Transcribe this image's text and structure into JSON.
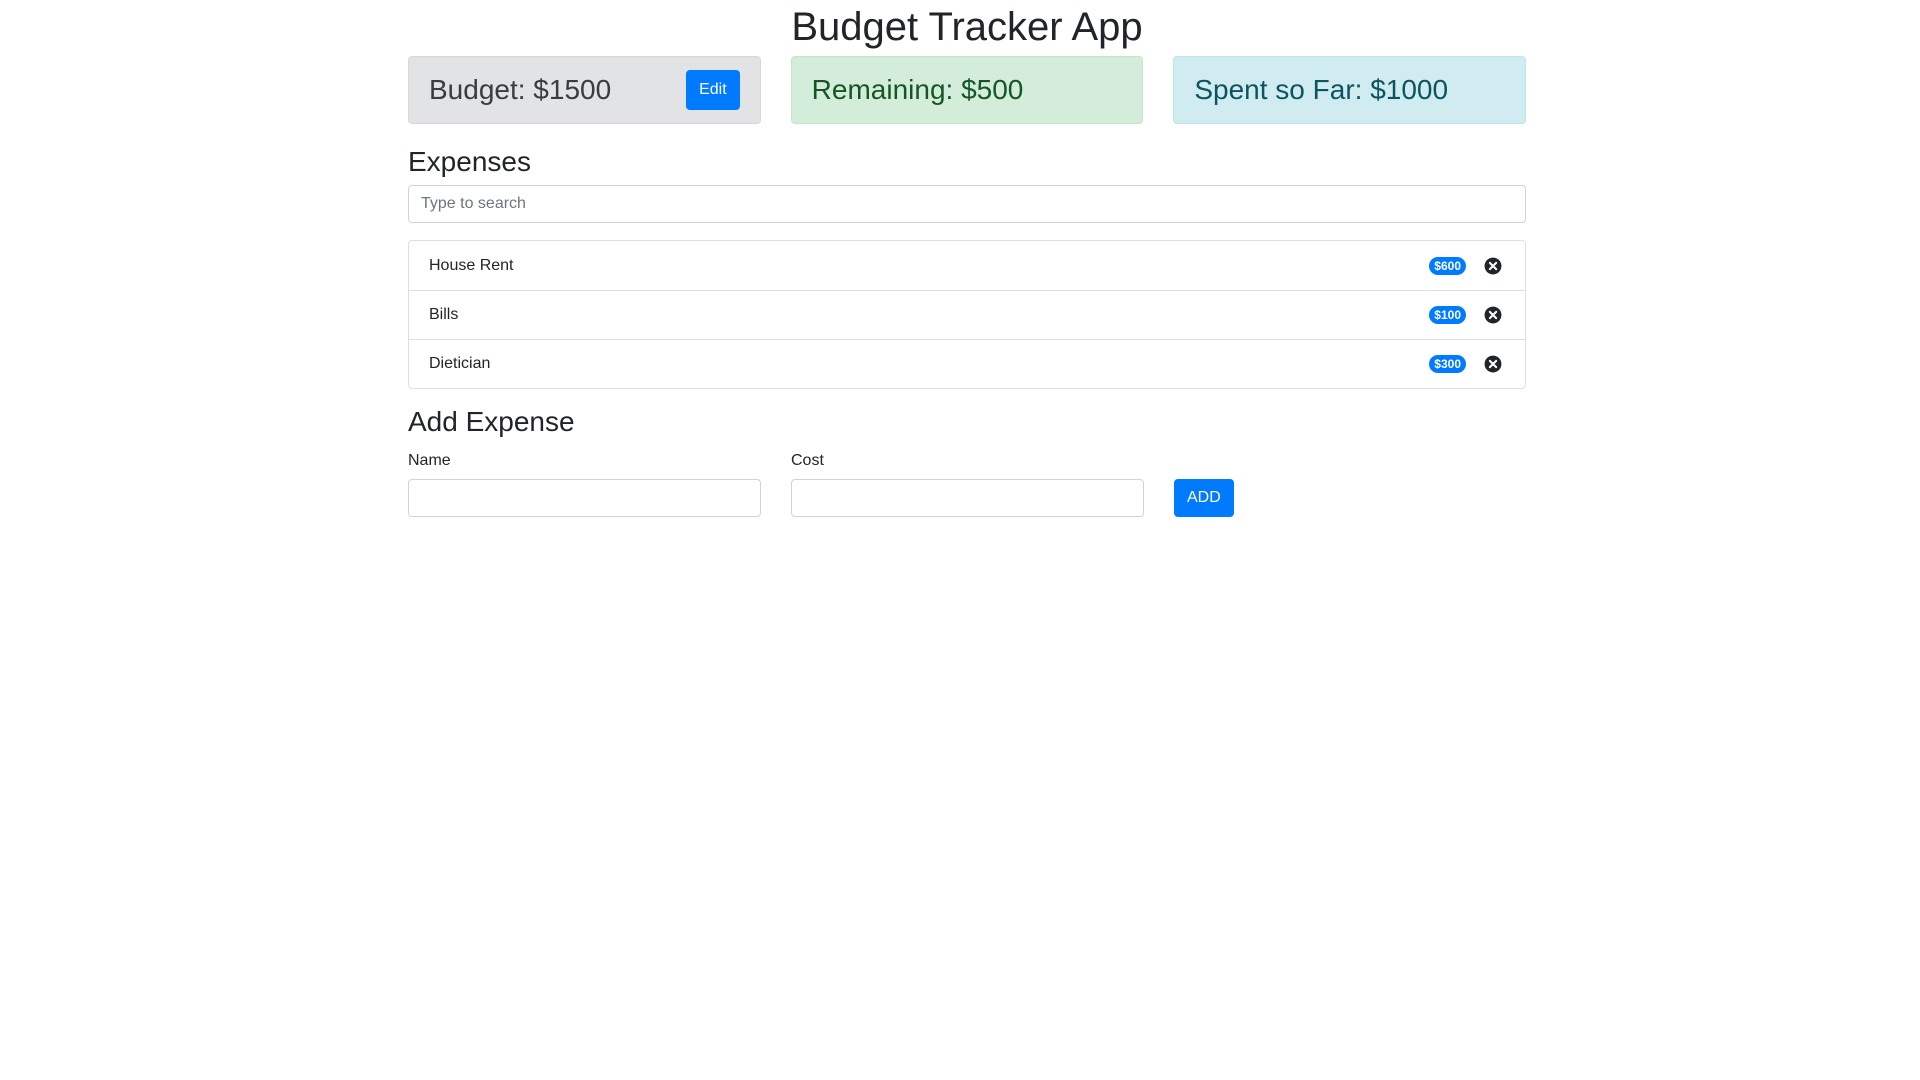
{
  "app": {
    "title": "Budget Tracker App"
  },
  "summary": {
    "budget_label": "Budget: $1500",
    "edit_label": "Edit",
    "remaining_label": "Remaining: $500",
    "spent_label": "Spent so Far: $1000"
  },
  "expenses": {
    "title": "Expenses",
    "search_placeholder": "Type to search",
    "items": [
      {
        "name": "House Rent",
        "cost": "$600"
      },
      {
        "name": "Bills",
        "cost": "$100"
      },
      {
        "name": "Dietician",
        "cost": "$300"
      }
    ]
  },
  "add_expense": {
    "title": "Add Expense",
    "name_label": "Name",
    "cost_label": "Cost",
    "add_label": "ADD"
  },
  "icons": {
    "delete": "close-circle-icon"
  },
  "colors": {
    "primary": "#007bff",
    "budget_bg": "#e2e3e5",
    "remaining_bg": "#d4edda",
    "spent_bg": "#d1ecf1"
  }
}
